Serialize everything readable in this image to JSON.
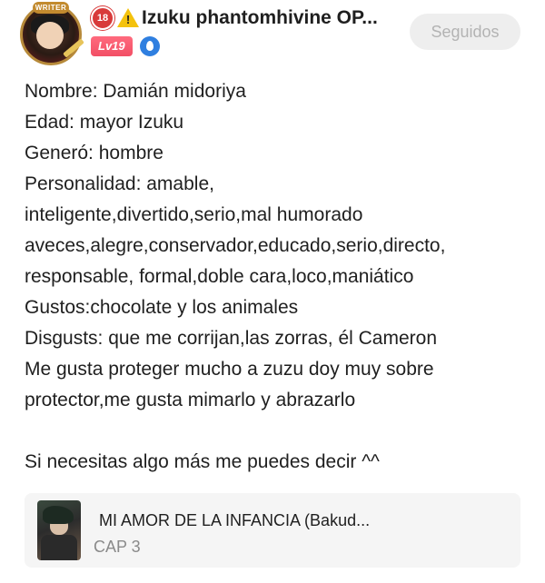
{
  "profile": {
    "avatar_label": "WRITER",
    "age_badge": "18",
    "display_name": "Izuku phantomhivine OP...",
    "level": "Lv19",
    "follow_button_label": "Seguidos"
  },
  "bio": {
    "lines": [
      "Nombre: Damián midoriya",
      "Edad: mayor Izuku",
      "Generó: hombre",
      "Personalidad: amable,",
      "inteligente,divertido,serio,mal humorado",
      "aveces,alegre,conservador,educado,serio,directo,",
      "responsable, formal,doble cara,loco,maniático",
      "Gustos:chocolate y los animales",
      "Disgusts: que me corrijan,las zorras, él Cameron",
      "Me gusta proteger mucho a zuzu doy muy sobre",
      "protector,me gusta mimarlo y abrazarlo",
      "",
      "Si necesitas algo más me puedes decir ^^"
    ]
  },
  "linked_post": {
    "title": "MI AMOR DE LA INFANCIA  (Bakud...",
    "subtitle": "CAP 3"
  },
  "icons": {
    "age_badge": "age-restriction-icon",
    "warning": "warning-icon",
    "verified": "verified-icon"
  },
  "colors": {
    "level_badge": "#f24f65",
    "verified": "#2f7fe0",
    "warning": "#f4c20d",
    "age_badge": "#d83a3a"
  }
}
